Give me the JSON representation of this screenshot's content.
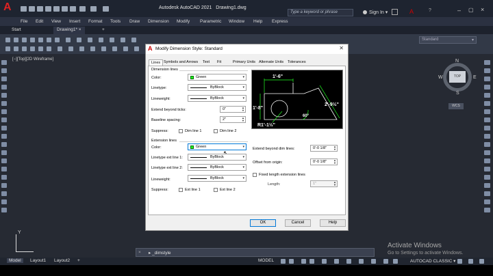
{
  "app": {
    "title": "Autodesk AutoCAD 2021",
    "document": "Drawing1.dwg",
    "search_placeholder": "Type a keyword or phrase",
    "sign_in": "Sign In",
    "logo": "A"
  },
  "menu": [
    "File",
    "Edit",
    "View",
    "Insert",
    "Format",
    "Tools",
    "Draw",
    "Dimension",
    "Modify",
    "Parametric",
    "Window",
    "Help",
    "Express"
  ],
  "tabs": {
    "start": "Start",
    "drawing": "Drawing1*",
    "add": "+"
  },
  "toolbar": {
    "style_combo": "Standard"
  },
  "viewport": {
    "label": "[−][Top][2D Wireframe]",
    "cube_label": "TOP",
    "wcs": "WCS",
    "n": "N",
    "s": "S",
    "e": "E",
    "w": "W",
    "y_axis": "Y"
  },
  "command": {
    "text": "▸ _dimstyle",
    "close": "×"
  },
  "status": {
    "model_tab": "Model",
    "layout1": "Layout1",
    "layout2": "Layout2",
    "add": "+",
    "model": "MODEL",
    "annotation": "AUTOCAD CLASSIC ▾"
  },
  "watermark": {
    "line1": "Activate Windows",
    "line2": "Go to Settings to activate Windows."
  },
  "dialog": {
    "title": "Modify Dimension Style: Standard",
    "tabs": [
      "Lines",
      "Symbols and Arrows",
      "Text",
      "Fit",
      "Primary Units",
      "Alternate Units",
      "Tolerances"
    ],
    "dimension_lines": {
      "group": "Dimension lines",
      "color_label": "Color:",
      "color": "Green",
      "linetype_label": "Linetype:",
      "linetype": "ByBlock",
      "lineweight_label": "Lineweight:",
      "lineweight": "ByBlock",
      "extend_ticks_label": "Extend beyond ticks:",
      "extend_ticks": "0\"",
      "baseline_label": "Baseline spacing:",
      "baseline": "2\"",
      "suppress_label": "Suppress:",
      "dim_line1": "Dim line 1",
      "dim_line2": "Dim line 2"
    },
    "extension_lines": {
      "group": "Extension lines",
      "color_label": "Color:",
      "color": "Green",
      "linetype1_label": "Linetype ext line 1:",
      "linetype1": "ByBlock",
      "linetype2_label": "Linetype ext line 2:",
      "linetype2": "ByBlock",
      "lineweight_label": "Lineweight:",
      "lineweight": "ByBlock",
      "suppress_label": "Suppress:",
      "ext_line1": "Ext line 1",
      "ext_line2": "Ext line 2",
      "extend_dim_label": "Extend beyond dim lines:",
      "extend_dim": "0'-0 1/8\"",
      "offset_label": "Offset from origin:",
      "offset": "0'-0 1/8\"",
      "fixed_label": "Fixed length extension lines",
      "length_label": "Length:",
      "length": "1\""
    },
    "preview": {
      "dim_top": "1'-6\"",
      "dim_left": "1'-8\"",
      "dim_right": "2'-9½\"",
      "angle": "60°",
      "radius": "R1'-1½\""
    },
    "buttons": {
      "ok": "OK",
      "cancel": "Cancel",
      "help": "Help"
    }
  },
  "colors": {
    "accent": "#0078d7",
    "green_swatch": "#22ff22",
    "dim_color": "#22ff22"
  }
}
